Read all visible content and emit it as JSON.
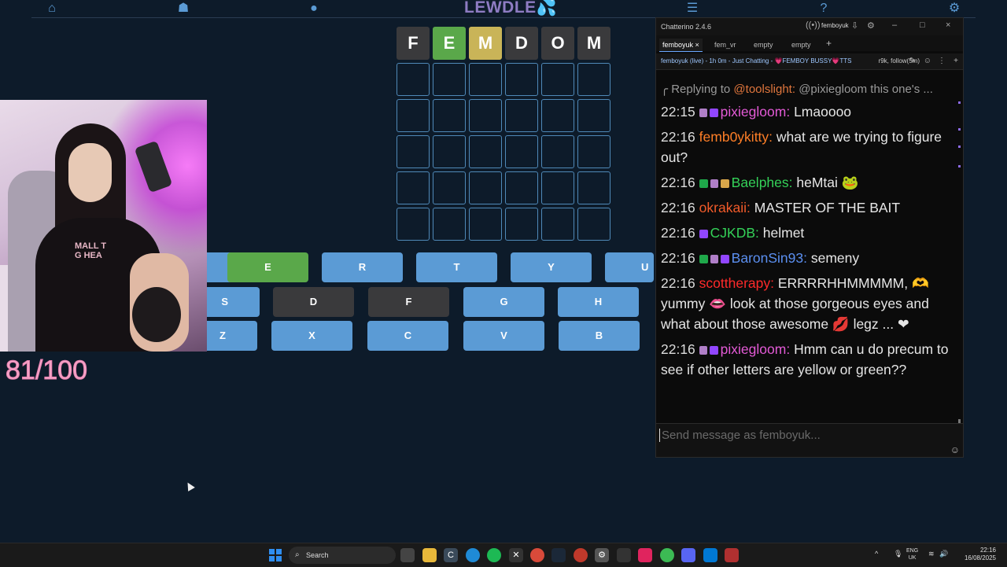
{
  "nav": {
    "logo_main": "LEWDLE",
    "logo_drop": "💦"
  },
  "grid": {
    "rows": [
      [
        {
          "letter": "F",
          "state": "grey"
        },
        {
          "letter": "E",
          "state": "green"
        },
        {
          "letter": "M",
          "state": "yellow"
        },
        {
          "letter": "D",
          "state": "grey"
        },
        {
          "letter": "O",
          "state": "grey"
        },
        {
          "letter": "M",
          "state": "grey"
        }
      ],
      [
        {
          "letter": "",
          "state": "empty"
        },
        {
          "letter": "",
          "state": "empty"
        },
        {
          "letter": "",
          "state": "empty"
        },
        {
          "letter": "",
          "state": "empty"
        },
        {
          "letter": "",
          "state": "empty"
        },
        {
          "letter": "",
          "state": "empty"
        }
      ],
      [
        {
          "letter": "",
          "state": "empty"
        },
        {
          "letter": "",
          "state": "empty"
        },
        {
          "letter": "",
          "state": "empty"
        },
        {
          "letter": "",
          "state": "empty"
        },
        {
          "letter": "",
          "state": "empty"
        },
        {
          "letter": "",
          "state": "empty"
        }
      ],
      [
        {
          "letter": "",
          "state": "empty"
        },
        {
          "letter": "",
          "state": "empty"
        },
        {
          "letter": "",
          "state": "empty"
        },
        {
          "letter": "",
          "state": "empty"
        },
        {
          "letter": "",
          "state": "empty"
        },
        {
          "letter": "",
          "state": "empty"
        }
      ],
      [
        {
          "letter": "",
          "state": "empty"
        },
        {
          "letter": "",
          "state": "empty"
        },
        {
          "letter": "",
          "state": "empty"
        },
        {
          "letter": "",
          "state": "empty"
        },
        {
          "letter": "",
          "state": "empty"
        },
        {
          "letter": "",
          "state": "empty"
        }
      ],
      [
        {
          "letter": "",
          "state": "empty"
        },
        {
          "letter": "",
          "state": "empty"
        },
        {
          "letter": "",
          "state": "empty"
        },
        {
          "letter": "",
          "state": "empty"
        },
        {
          "letter": "",
          "state": "empty"
        },
        {
          "letter": "",
          "state": "empty"
        }
      ]
    ]
  },
  "keyboard": {
    "row1": [
      {
        "key": "",
        "state": "blue"
      },
      {
        "key": "E",
        "state": "green"
      },
      {
        "key": "R",
        "state": "blue"
      },
      {
        "key": "T",
        "state": "blue"
      },
      {
        "key": "Y",
        "state": "blue"
      },
      {
        "key": "U",
        "state": "blue"
      }
    ],
    "row2": [
      {
        "key": "S",
        "state": "blue"
      },
      {
        "key": "D",
        "state": "dark"
      },
      {
        "key": "F",
        "state": "dark"
      },
      {
        "key": "G",
        "state": "blue"
      },
      {
        "key": "H",
        "state": "blue"
      }
    ],
    "row3": [
      {
        "key": "Z",
        "state": "blue"
      },
      {
        "key": "X",
        "state": "blue"
      },
      {
        "key": "C",
        "state": "blue"
      },
      {
        "key": "V",
        "state": "blue"
      },
      {
        "key": "B",
        "state": "blue"
      }
    ]
  },
  "webcam": {
    "shirt_text_1": "MALL T",
    "shirt_text_2": "G HEA"
  },
  "score": {
    "text": "81/100"
  },
  "chat": {
    "window_title": "Chatterino 2.4.6",
    "account": "femboyuk",
    "tabs": [
      "femboyuk",
      "fem_vr",
      "empty",
      "empty"
    ],
    "tab_close": "×",
    "tab_add": "+",
    "status": "femboyuk (live) - 1h 0m - Just Chatting - 💗FEMBOY BUSSY💗TTS",
    "status_right": "r9k, follow(5m)",
    "reply_prefix": "╭ Replying to ",
    "reply_to": "@toolslight:",
    "reply_text": " @pixiegloom this one's ...",
    "messages": [
      {
        "ts": "22:15",
        "badges": [
          "wiz",
          "purple"
        ],
        "user": "pixiegloom:",
        "color": "#e35ad6",
        "text": " Lmaoooo"
      },
      {
        "ts": "22:16",
        "badges": [],
        "user": "femb0ykitty:",
        "color": "#ff7f27",
        "text": " what are we trying to figure out?"
      },
      {
        "ts": "22:16",
        "badges": [
          "green",
          "wiz",
          "gold"
        ],
        "user": "Baelphes:",
        "color": "#34d158",
        "text": " heMtai 🐸"
      },
      {
        "ts": "22:16",
        "badges": [],
        "user": "okrakaii:",
        "color": "#f25b2a",
        "text": " MASTER OF THE BAIT"
      },
      {
        "ts": "22:16",
        "badges": [
          "purple"
        ],
        "user": "CJKDB:",
        "color": "#34d158",
        "text": " helmet"
      },
      {
        "ts": "22:16",
        "badges": [
          "green",
          "wiz",
          "purple"
        ],
        "user": "BaronSin93:",
        "color": "#5b8ff0",
        "text": " semeny"
      },
      {
        "ts": "22:16",
        "badges": [],
        "user": "scottherapy:",
        "color": "#ff2a2a",
        "text": " ERRRRHHMMMMM, 🫶 yummy 👄 look at those gorgeous eyes and what about those awesome 💋 legz ... ❤"
      },
      {
        "ts": "22:16",
        "badges": [
          "wiz",
          "purple"
        ],
        "user": "pixiegloom:",
        "color": "#e35ad6",
        "text": " Hmm can u do precum to see if other letters are yellow or green??"
      }
    ],
    "input_placeholder": "Send message as femboyuk..."
  },
  "taskbar": {
    "search_label": "Search",
    "lang_1": "ENG",
    "lang_2": "UK",
    "time": "22:16",
    "date": "16/08/2025"
  }
}
